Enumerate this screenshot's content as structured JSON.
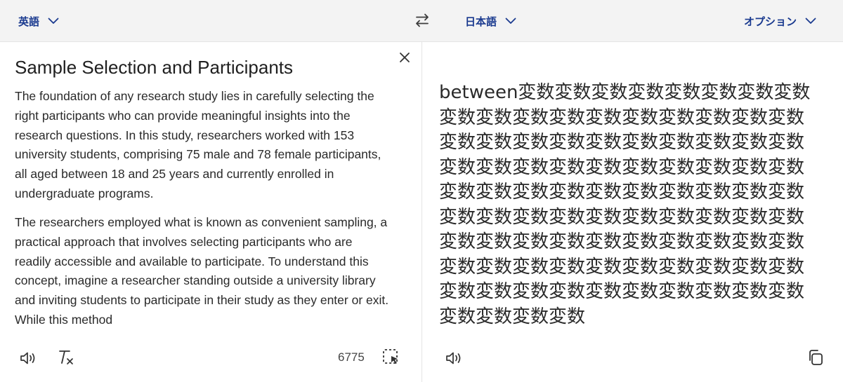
{
  "topbar": {
    "source_language": "英語",
    "target_language": "日本語",
    "options_label": "オプション"
  },
  "source": {
    "title": "Sample Selection and Participants",
    "paragraphs": [
      "The foundation of any research study lies in carefully selecting the right participants who can provide meaningful insights into the research questions. In this study, researchers worked with 153 university students, comprising 75 male and 78 female participants, all aged between 18 and 25 years and currently enrolled in undergraduate programs.",
      "The researchers employed what is known as convenient sampling, a practical approach that involves selecting participants who are readily accessible and available to participate. To understand this concept, imagine a researcher standing outside a university library and inviting students to participate in their study as they enter or exit. While this method"
    ],
    "character_count": "6775"
  },
  "target": {
    "translated_text": "between変数変数変数変数変数変数変数変数変数変数変数変数変数変数変数変数変数変数変数変数変数変数変数変数変数変数変数変数変数変数変数変数変数変数変数変数変数変数変数変数変数変数変数変数変数変数変数変数変数変数変数変数変数変数変数変数変数変数変数変数変数変数変数変数変数変数変数変数変数変数変数変数変数変数変数変数変数変数変数変数変数変数変数変数変数変数変数変数変数変数変数変数"
  },
  "icons": {
    "source_language_dropdown": "chevron-down-icon",
    "swap": "swap-arrows-icon",
    "target_language_dropdown": "chevron-down-icon",
    "options_dropdown": "chevron-down-icon",
    "clear": "close-icon",
    "listen_source": "speaker-icon",
    "clear_formatting": "clear-format-icon",
    "select_text": "dashed-selection-cursor-icon",
    "listen_target": "speaker-icon",
    "copy": "copy-icon"
  },
  "colors": {
    "accent": "#1a3a8f",
    "topbar_background": "#f3f3f3",
    "text": "#2a2a2a"
  }
}
